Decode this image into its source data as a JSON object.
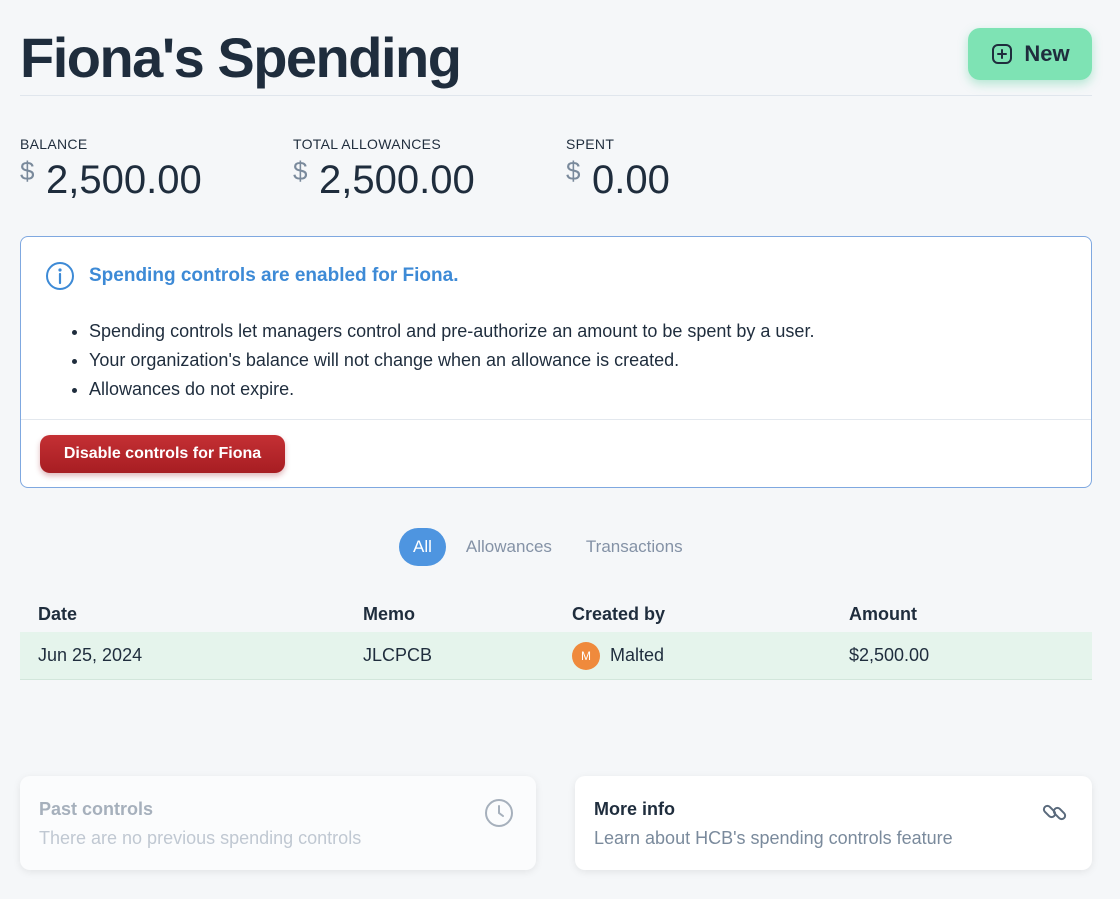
{
  "header": {
    "title": "Fiona's Spending",
    "new_label": "New"
  },
  "stats": [
    {
      "label": "BALANCE",
      "currency": "$",
      "amount": "2,500.00"
    },
    {
      "label": "TOTAL ALLOWANCES",
      "currency": "$",
      "amount": "2,500.00"
    },
    {
      "label": "SPENT",
      "currency": "$",
      "amount": "0.00"
    }
  ],
  "info": {
    "title": "Spending controls are enabled for Fiona.",
    "bullets": [
      "Spending controls let managers control and pre-authorize an amount to be spent by a user.",
      "Your organization's balance will not change when an allowance is created.",
      "Allowances do not expire."
    ],
    "disable_label": "Disable controls for Fiona"
  },
  "tabs": [
    "All",
    "Allowances",
    "Transactions"
  ],
  "table": {
    "headers": [
      "Date",
      "Memo",
      "Created by",
      "Amount"
    ],
    "rows": [
      {
        "date": "Jun 25, 2024",
        "memo": "JLCPCB",
        "avatar": "M",
        "created_by": "Malted",
        "amount": "$2,500.00"
      }
    ]
  },
  "cards": {
    "past": {
      "title": "Past controls",
      "subtitle": "There are no previous spending controls",
      "icon": "clock-icon"
    },
    "more": {
      "title": "More info",
      "subtitle": "Learn about HCB's spending controls feature",
      "icon": "link-icon"
    }
  },
  "colors": {
    "accent_green": "#7ee3b4",
    "accent_blue": "#3d8ad6",
    "danger": "#b8252a",
    "row_highlight": "#e5f4ec"
  }
}
